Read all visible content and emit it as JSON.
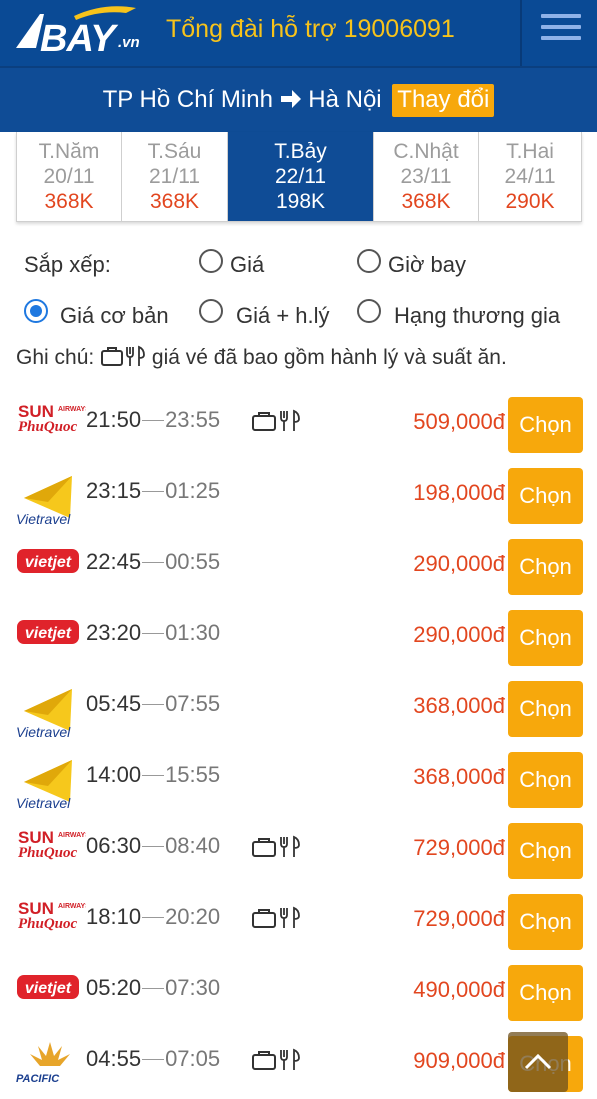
{
  "header": {
    "logo_text": "BAY",
    "logo_suffix": ".vn",
    "hotline": "Tổng đài hỗ trợ 19006091",
    "menu_icon": "hamburger-menu-icon"
  },
  "route": {
    "from": "TP Hồ Chí Minh",
    "to": "Hà Nội",
    "change_label": "Thay đổi"
  },
  "date_tabs": [
    {
      "day": "T.Năm",
      "date": "20/11",
      "price": "368K",
      "active": false
    },
    {
      "day": "T.Sáu",
      "date": "21/11",
      "price": "368K",
      "active": false
    },
    {
      "day": "T.Bảy",
      "date": "22/11",
      "price": "198K",
      "active": true
    },
    {
      "day": "C.Nhật",
      "date": "23/11",
      "price": "368K",
      "active": false
    },
    {
      "day": "T.Hai",
      "date": "24/11",
      "price": "290K",
      "active": false
    }
  ],
  "sort": {
    "label": "Sắp xếp:",
    "options": [
      "Giá",
      "Giờ bay"
    ]
  },
  "fare_type": {
    "options": [
      "Giá cơ bản",
      "Giá + h.lý",
      "Hạng thương gia"
    ],
    "selected": "Giá cơ bản"
  },
  "note": {
    "prefix": "Ghi chú:",
    "text": "giá vé đã bao gồm hành lý và suất ăn."
  },
  "flights": [
    {
      "airline": "Sun PhuQuoc Airways",
      "logo_text": "SUN",
      "logo_sub": "PhuQuoc",
      "logo_small": "AIRWAYS",
      "depart": "21:50",
      "arrive": "23:55",
      "amenities": true,
      "price": "509,000đ",
      "button": "Chọn"
    },
    {
      "airline": "Vietravel",
      "logo_text": "Vietravel",
      "depart": "23:15",
      "arrive": "01:25",
      "amenities": false,
      "price": "198,000đ",
      "button": "Chọn"
    },
    {
      "airline": "Vietjet",
      "logo_text": "vietjet",
      "depart": "22:45",
      "arrive": "00:55",
      "amenities": false,
      "price": "290,000đ",
      "button": "Chọn"
    },
    {
      "airline": "Vietjet",
      "logo_text": "vietjet",
      "depart": "23:20",
      "arrive": "01:30",
      "amenities": false,
      "price": "290,000đ",
      "button": "Chọn"
    },
    {
      "airline": "Vietravel",
      "logo_text": "Vietravel",
      "depart": "05:45",
      "arrive": "07:55",
      "amenities": false,
      "price": "368,000đ",
      "button": "Chọn"
    },
    {
      "airline": "Vietravel",
      "logo_text": "Vietravel",
      "depart": "14:00",
      "arrive": "15:55",
      "amenities": false,
      "price": "368,000đ",
      "button": "Chọn"
    },
    {
      "airline": "Sun PhuQuoc Airways",
      "logo_text": "SUN",
      "logo_sub": "PhuQuoc",
      "logo_small": "AIRWAYS",
      "depart": "06:30",
      "arrive": "08:40",
      "amenities": true,
      "price": "729,000đ",
      "button": "Chọn"
    },
    {
      "airline": "Sun PhuQuoc Airways",
      "logo_text": "SUN",
      "logo_sub": "PhuQuoc",
      "logo_small": "AIRWAYS",
      "depart": "18:10",
      "arrive": "20:20",
      "amenities": true,
      "price": "729,000đ",
      "button": "Chọn"
    },
    {
      "airline": "Vietjet",
      "logo_text": "vietjet",
      "depart": "05:20",
      "arrive": "07:30",
      "amenities": false,
      "price": "490,000đ",
      "button": "Chọn"
    },
    {
      "airline": "Pacific Airlines",
      "logo_text": "PACIFIC",
      "depart": "04:55",
      "arrive": "07:05",
      "amenities": true,
      "price": "909,000đ",
      "button": "Chọn"
    }
  ],
  "colors": {
    "header_bg": "#0a4a95",
    "accent_orange": "#f7a80c",
    "price_red": "#e2461f",
    "hotline_yellow": "#f7c31b"
  },
  "scroll_top_icon": "chevron-up-icon"
}
